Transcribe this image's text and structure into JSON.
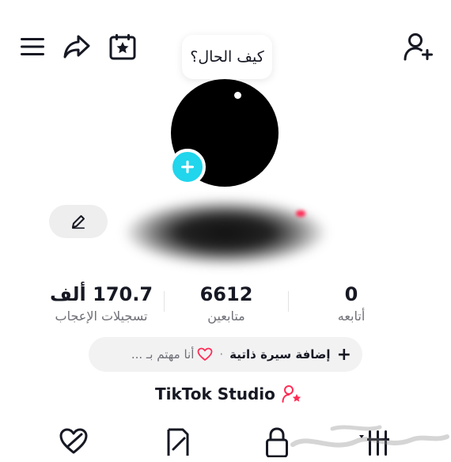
{
  "header": {
    "icons": [
      "menu-icon",
      "share-icon",
      "calendar-star-icon",
      "add-user-icon"
    ]
  },
  "status_bubble": {
    "text": "كيف الحال؟"
  },
  "profile": {
    "display_name": ""
  },
  "stats": {
    "likes": {
      "value": "170.7 ألف",
      "label": "تسجيلات الإعجاب"
    },
    "followers": {
      "value": "6612",
      "label": "متابعين"
    },
    "following": {
      "value": "0",
      "label": "أتابعه"
    }
  },
  "bio": {
    "add_label": "إضافة سيرة ذاتية",
    "separator": "·",
    "interest_label": "أنا مهتم بـ ..."
  },
  "studio": {
    "label": "TikTok Studio"
  },
  "tabs": [
    "liked-tab",
    "favorites-tab",
    "private-tab",
    "videos-tab"
  ],
  "colors": {
    "accent": "#20d5ec",
    "brand_red": "#fe2c55",
    "text": "#161823",
    "muted": "#6f7077"
  }
}
